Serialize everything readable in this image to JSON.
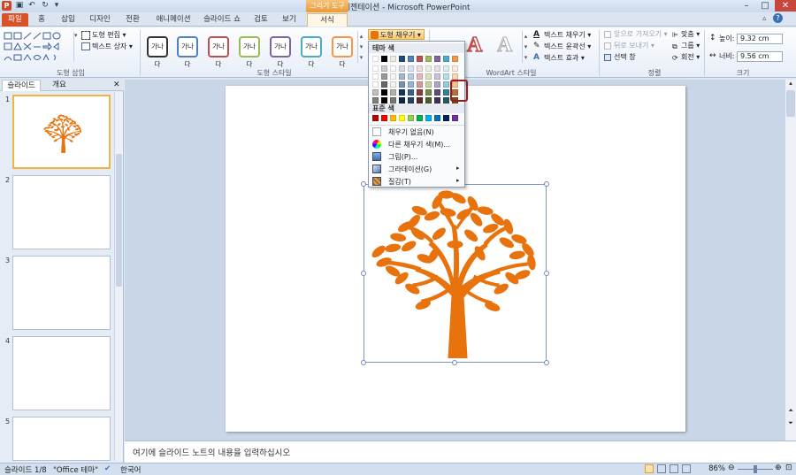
{
  "titlebar": {
    "title": "새 프레젠테이션 - Microsoft PowerPoint",
    "contextual_tab": "그리기 도구",
    "app_icon": "P"
  },
  "tabs": [
    "파일",
    "홈",
    "삽입",
    "디자인",
    "전환",
    "애니메이션",
    "슬라이드 쇼",
    "검토",
    "보기",
    "서식"
  ],
  "ribbon": {
    "insert_shapes": {
      "label": "도형 삽입",
      "edit_shape": "도형 편집 ▾",
      "text_box": "텍스트 상자 ▾"
    },
    "shape_styles": {
      "label": "도형 스타일",
      "style_text": "가나다",
      "style_colors": [
        "#333333",
        "#4f81bd",
        "#c0504d",
        "#9bbb59",
        "#8064a2",
        "#4bacc6",
        "#f79646"
      ],
      "shape_fill": "도형 채우기 ▾"
    },
    "wordart": {
      "label": "WordArt 스타일",
      "text_fill": "텍스트 채우기 ▾",
      "text_outline": "텍스트 윤곽선 ▾",
      "text_effects": "텍스트 효과 ▾"
    },
    "arrange": {
      "label": "정렬",
      "bring_forward": "앞으로 가져오기 ▾",
      "send_backward": "뒤로 보내기 ▾",
      "selection_pane": "선택 창",
      "align": "맞춤 ▾",
      "group": "그룹 ▾",
      "rotate": "회전 ▾"
    },
    "size": {
      "label": "크기",
      "height_label": "높이:",
      "height_value": "9.32 cm",
      "width_label": "너비:",
      "width_value": "9.56 cm"
    }
  },
  "slide_pane": {
    "tabs": [
      "슬라이드",
      "개요"
    ],
    "slide_numbers": [
      "1",
      "2",
      "3",
      "4",
      "5"
    ]
  },
  "dropdown": {
    "theme_colors_label": "테마 색",
    "standard_colors_label": "표준 색",
    "theme_colors_top": [
      "#ffffff",
      "#000000",
      "#eeece1",
      "#1f497d",
      "#4f81bd",
      "#c0504d",
      "#9bbb59",
      "#8064a2",
      "#4bacc6",
      "#f79646"
    ],
    "standard_colors": [
      "#c00000",
      "#ff0000",
      "#ffc000",
      "#ffff00",
      "#92d050",
      "#00b050",
      "#00b0f0",
      "#0070c0",
      "#002060",
      "#7030a0"
    ],
    "items": {
      "no_fill": "채우기 없음(N)",
      "more_colors": "다른 채우기 색(M)...",
      "picture": "그림(P)...",
      "gradient": "그라데이션(G)",
      "texture": "질감(T)"
    }
  },
  "slide": {
    "tree_color": "#e8720c"
  },
  "notes": {
    "placeholder": "여기에 슬라이드 노트의 내용을 입력하십시오"
  },
  "status": {
    "slide_info": "슬라이드 1/8",
    "theme": "\"Office 테마\"",
    "language": "한국어",
    "zoom": "86%"
  }
}
